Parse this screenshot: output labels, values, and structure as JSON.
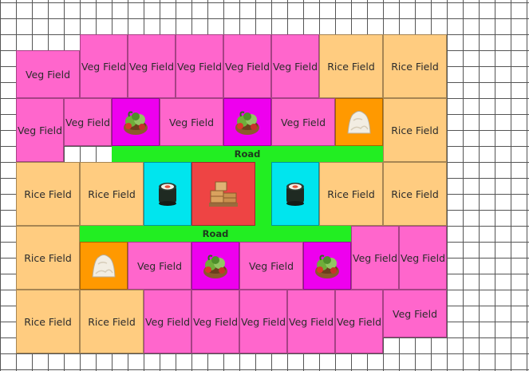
{
  "colors": {
    "veg": "#ff66cc",
    "rice": "#ffcc80",
    "veg_processor": "#ee00ee",
    "rice_processor": "#ff9900",
    "sushi_shop": "#00e5ee",
    "warehouse": "#ee4444",
    "road": "#22ee22"
  },
  "tiles": [
    {
      "kind": "veg",
      "label": "Veg Field"
    },
    {
      "kind": "veg",
      "label": "Veg Field"
    },
    {
      "kind": "veg",
      "label": "Veg Field"
    },
    {
      "kind": "veg",
      "label": "Veg Field"
    },
    {
      "kind": "veg",
      "label": "Veg Field"
    },
    {
      "kind": "veg",
      "label": "Veg Field"
    },
    {
      "kind": "rice",
      "label": "Rice Field"
    },
    {
      "kind": "rice",
      "label": "Rice Field"
    },
    {
      "kind": "veg",
      "label": "Veg Field"
    },
    {
      "kind": "veg",
      "label": "Veg Field"
    },
    {
      "kind": "veg_processor",
      "icon": "vegetable-basket-icon"
    },
    {
      "kind": "veg",
      "label": "Veg Field"
    },
    {
      "kind": "veg_processor",
      "icon": "vegetable-basket-icon"
    },
    {
      "kind": "veg",
      "label": "Veg Field"
    },
    {
      "kind": "rice_processor",
      "icon": "rice-pile-icon"
    },
    {
      "kind": "rice",
      "label": "Rice Field"
    },
    {
      "kind": "rice",
      "label": "Rice Field"
    },
    {
      "kind": "rice",
      "label": "Rice Field"
    },
    {
      "kind": "sushi_shop",
      "icon": "sushi-roll-icon"
    },
    {
      "kind": "warehouse",
      "icon": "crates-icon"
    },
    {
      "kind": "sushi_shop",
      "icon": "sushi-roll-icon"
    },
    {
      "kind": "rice",
      "label": "Rice Field"
    },
    {
      "kind": "rice",
      "label": "Rice Field"
    },
    {
      "kind": "rice",
      "label": "Rice Field"
    },
    {
      "kind": "rice_processor",
      "icon": "rice-pile-icon"
    },
    {
      "kind": "veg",
      "label": "Veg Field"
    },
    {
      "kind": "veg_processor",
      "icon": "vegetable-basket-icon"
    },
    {
      "kind": "veg",
      "label": "Veg Field"
    },
    {
      "kind": "veg_processor",
      "icon": "vegetable-basket-icon"
    },
    {
      "kind": "veg",
      "label": "Veg Field"
    },
    {
      "kind": "veg",
      "label": "Veg Field"
    },
    {
      "kind": "rice",
      "label": "Rice Field"
    },
    {
      "kind": "rice",
      "label": "Rice Field"
    },
    {
      "kind": "veg",
      "label": "Veg Field"
    },
    {
      "kind": "veg",
      "label": "Veg Field"
    },
    {
      "kind": "veg",
      "label": "Veg Field"
    },
    {
      "kind": "veg",
      "label": "Veg Field"
    },
    {
      "kind": "veg",
      "label": "Veg Field"
    },
    {
      "kind": "veg",
      "label": "Veg Field"
    }
  ],
  "roads": [
    {
      "label": "Road"
    },
    {
      "label": "Road"
    },
    {
      "label": ""
    }
  ]
}
